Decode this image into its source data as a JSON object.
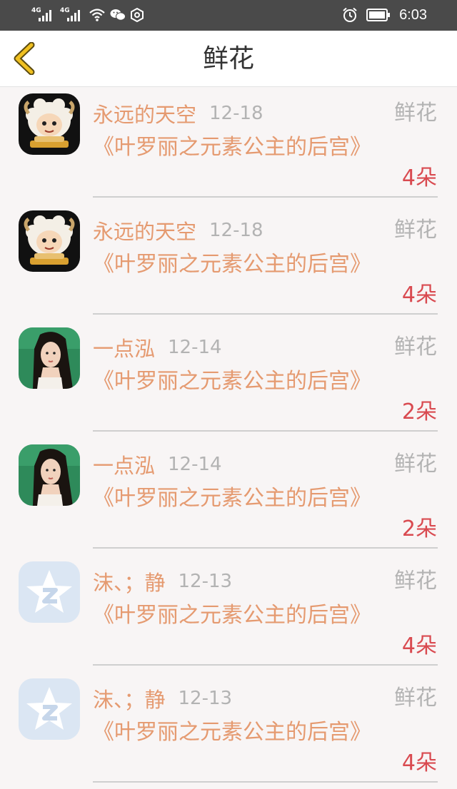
{
  "status_bar": {
    "signal1": "4G",
    "signal2": "4G",
    "time": "6:03"
  },
  "header": {
    "title": "鲜花"
  },
  "items": [
    {
      "name": "永远的天空",
      "date": "12-18",
      "kind": "鲜花",
      "book": "《叶罗丽之元素公主的后宫》",
      "count": "4朵",
      "avatar": "sheep-avatar"
    },
    {
      "name": "永远的天空",
      "date": "12-18",
      "kind": "鲜花",
      "book": "《叶罗丽之元素公主的后宫》",
      "count": "4朵",
      "avatar": "sheep-avatar"
    },
    {
      "name": "一点泓",
      "date": "12-14",
      "kind": "鲜花",
      "book": "《叶罗丽之元素公主的后宫》",
      "count": "2朵",
      "avatar": "woman-portrait-avatar"
    },
    {
      "name": "一点泓",
      "date": "12-14",
      "kind": "鲜花",
      "book": "《叶罗丽之元素公主的后宫》",
      "count": "2朵",
      "avatar": "woman-portrait-avatar"
    },
    {
      "name": "沫、；静",
      "date": "12-13",
      "kind": "鲜花",
      "book": "《叶罗丽之元素公主的后宫》",
      "count": "4朵",
      "avatar": "qzone-star-avatar"
    },
    {
      "name": "沫、；静",
      "date": "12-13",
      "kind": "鲜花",
      "book": "《叶罗丽之元素公主的后宫》",
      "count": "4朵",
      "avatar": "qzone-star-avatar"
    }
  ],
  "colors": {
    "status_bar_bg": "#4a4a4a",
    "name_orange": "#e59a70",
    "gray_text": "#b3b3b3",
    "count_red": "#d94a50",
    "back_arrow_yellow": "#f0c020"
  }
}
